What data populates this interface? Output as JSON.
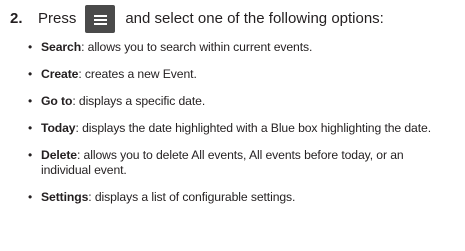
{
  "step": {
    "number": "2.",
    "text_before": "Press",
    "key_icon": "menu-icon",
    "text_after": "and select one of the following options:"
  },
  "options": [
    {
      "term": "Search",
      "description": ": allows you to search within current events."
    },
    {
      "term": "Create",
      "description": ": creates a new Event."
    },
    {
      "term": "Go to",
      "description": ": displays a specific date."
    },
    {
      "term": "Today",
      "description": ": displays the date highlighted with a Blue box highlighting the date."
    },
    {
      "term": "Delete",
      "description": ": allows you to delete All events, All events before today, or an individual event."
    },
    {
      "term": "Settings",
      "description": ": displays a list of configurable settings."
    }
  ],
  "colors": {
    "text": "#231f20",
    "key_background": "#4a4a4a"
  }
}
